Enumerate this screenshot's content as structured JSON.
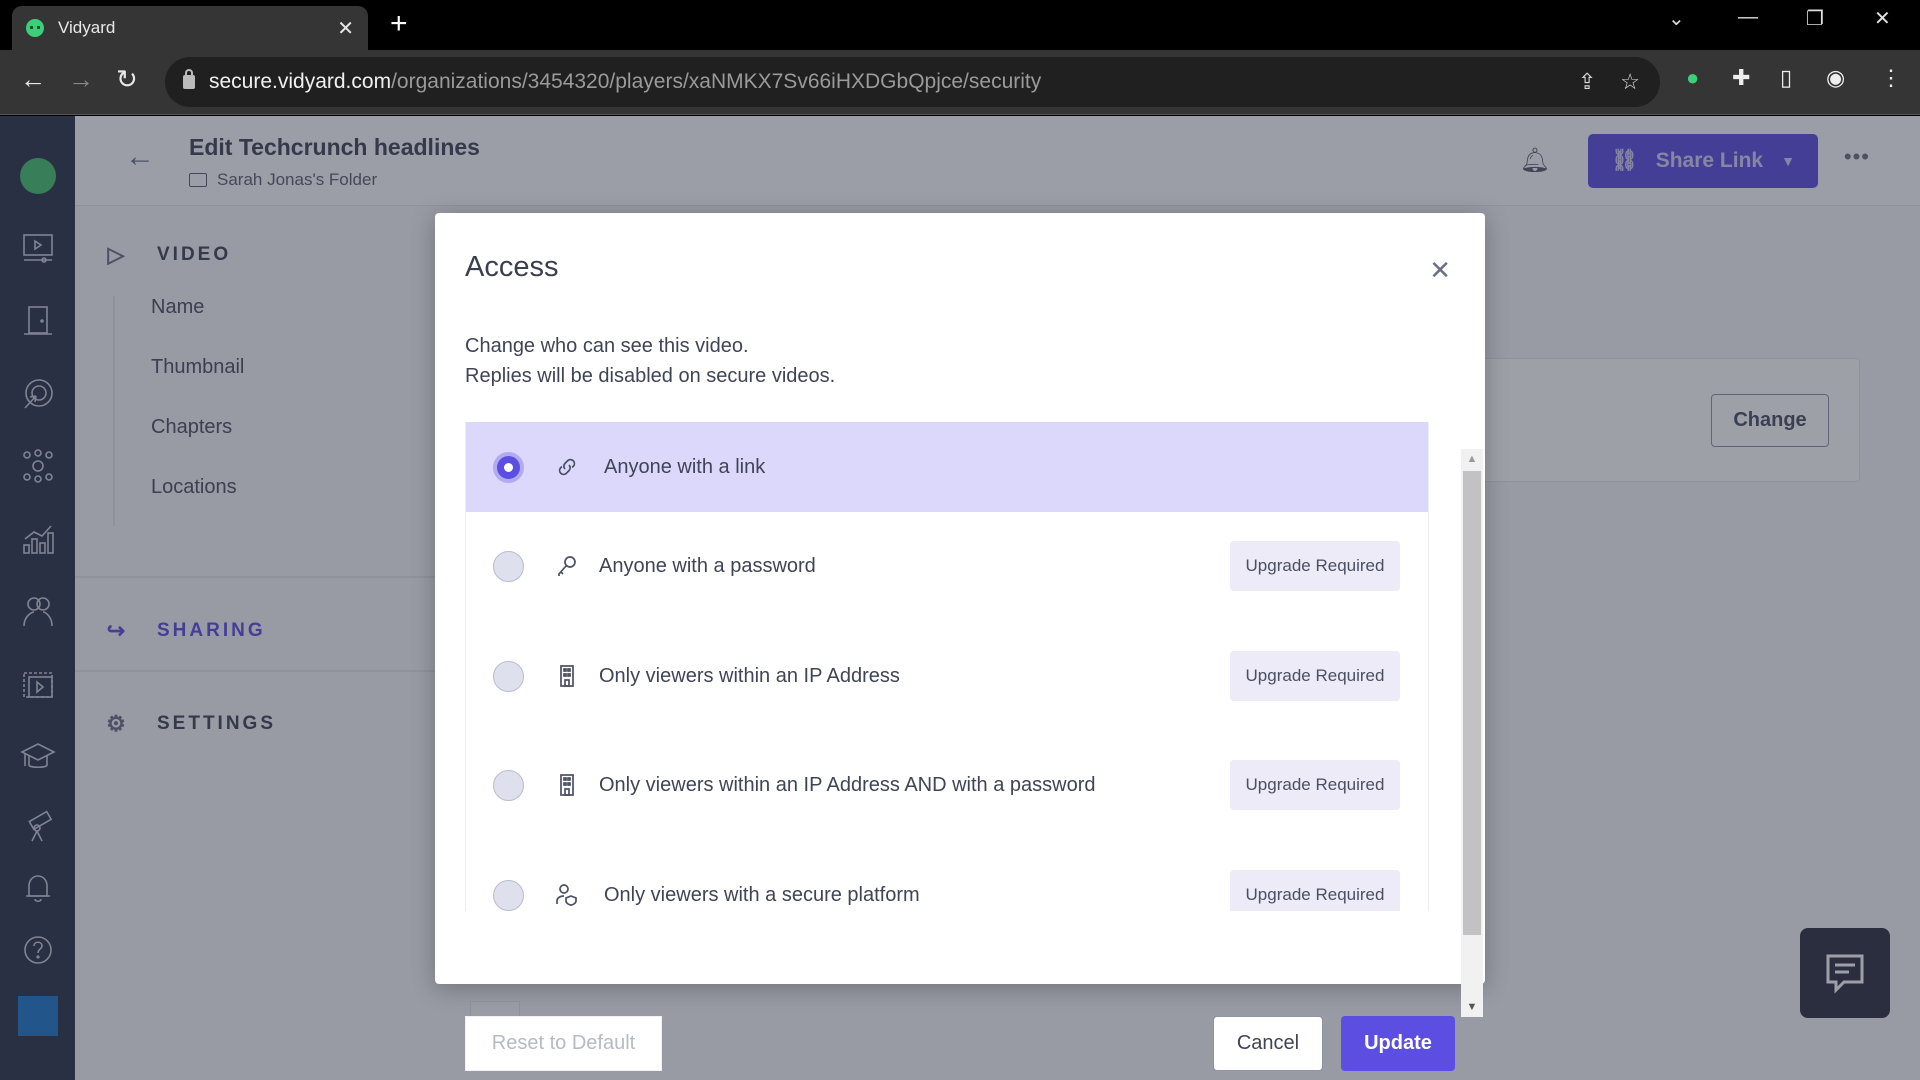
{
  "browser": {
    "tab_title": "Vidyard",
    "tab_close": "✕",
    "new_tab": "+",
    "url_host": "secure.vidyard.com",
    "url_path": "/organizations/3454320/players/xaNMKX7Sv66iHXDGbQpjce/security"
  },
  "header": {
    "title": "Edit Techcrunch headlines",
    "folder": "Sarah Jonas's Folder",
    "share_button": "Share Link",
    "more": "•••"
  },
  "sidenav": {
    "video_section": "VIDEO",
    "video_items": [
      "Name",
      "Thumbnail",
      "Chapters",
      "Locations"
    ],
    "sharing_section": "SHARING",
    "settings_section": "SETTINGS"
  },
  "content": {
    "change_button": "Change"
  },
  "modal": {
    "title": "Access",
    "close": "✕",
    "description_line1": "Change who can see this video.",
    "description_line2": "Replies will be disabled on secure videos.",
    "selected_option": "Anyone with a link",
    "options": [
      {
        "label": "Anyone with a link",
        "icon": "link-icon",
        "selected": true,
        "badge": ""
      },
      {
        "label": "Anyone with a password",
        "icon": "key-icon",
        "selected": false,
        "badge": "Upgrade Required"
      },
      {
        "label": "Only viewers within an IP Address",
        "icon": "building-icon",
        "selected": false,
        "badge": "Upgrade Required"
      },
      {
        "label": "Only viewers within an IP Address AND with a password",
        "icon": "building-icon",
        "selected": false,
        "badge": "Upgrade Required"
      },
      {
        "label": "Only viewers with a secure platform",
        "icon": "user-shield-icon",
        "selected": false,
        "badge": "Upgrade Required"
      }
    ],
    "reset_button": "Reset to Default",
    "cancel_button": "Cancel",
    "update_button": "Update"
  },
  "colors": {
    "accent": "#5b4ee0",
    "selected_row": "#dcd8fb",
    "rail": "#2b3347"
  }
}
